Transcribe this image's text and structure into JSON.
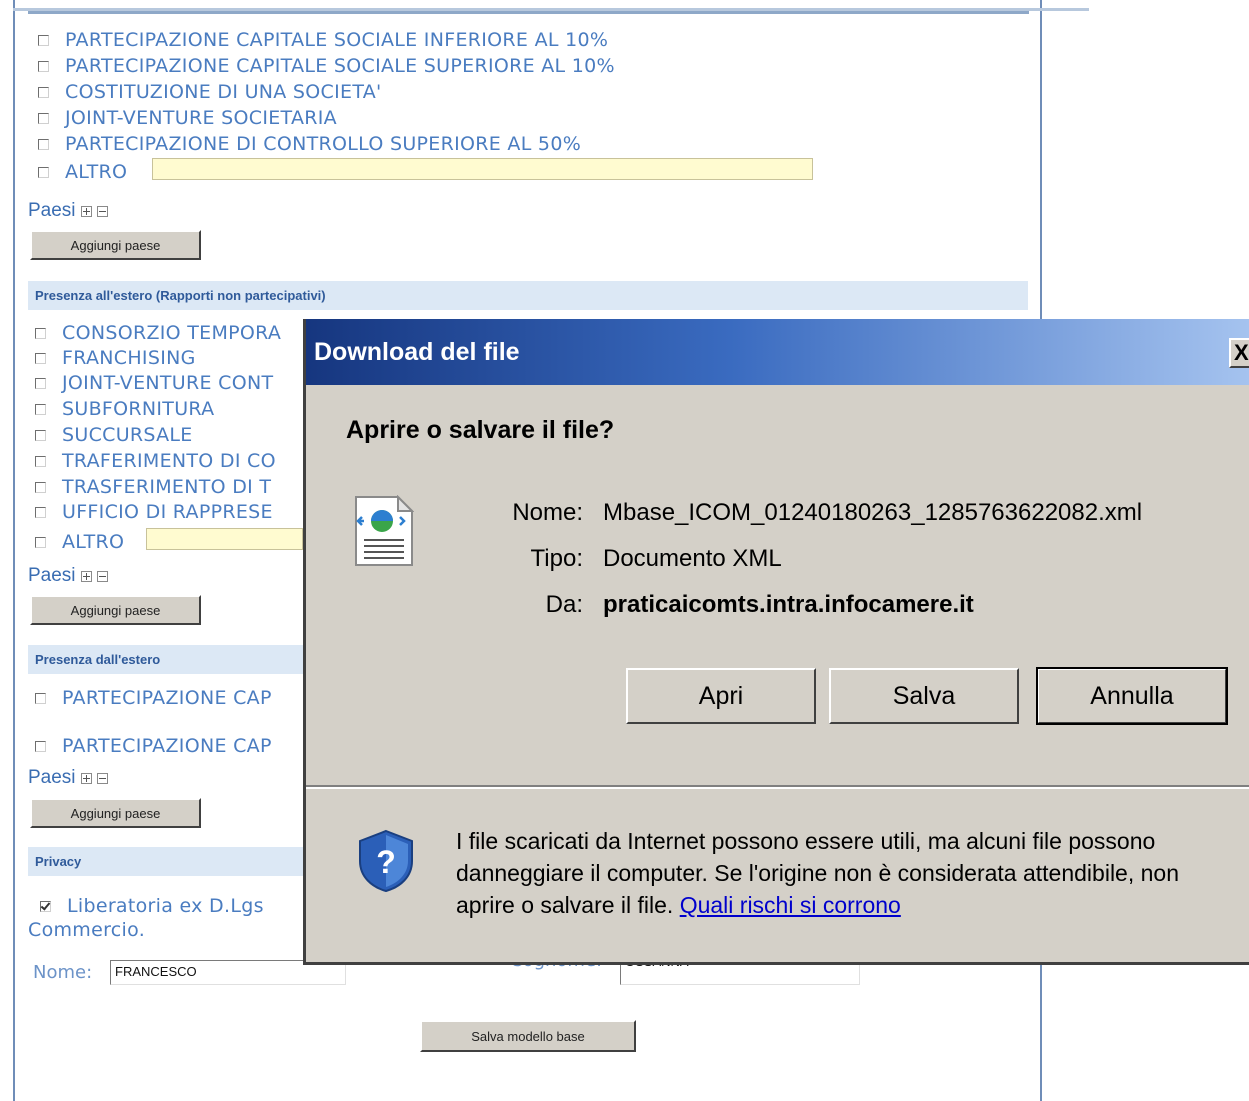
{
  "participations": {
    "options": [
      "PARTECIPAZIONE CAPITALE SOCIALE INFERIORE AL 10%",
      "PARTECIPAZIONE CAPITALE SOCIALE SUPERIORE AL 10%",
      "COSTITUZIONE DI UNA SOCIETA'",
      "JOINT-VENTURE SOCIETARIA",
      "PARTECIPAZIONE DI CONTROLLO SUPERIORE AL 50%",
      "ALTRO"
    ]
  },
  "paesi_label": "Paesi",
  "add_country_label": "Aggiungi paese",
  "section_non_participative": {
    "title": "Presenza all'estero (Rapporti non partecipativi)",
    "options": [
      "CONSORZIO TEMPORA",
      "FRANCHISING",
      "JOINT-VENTURE CONT",
      "SUBFORNITURA",
      "SUCCURSALE",
      "TRAFERIMENTO DI CO",
      "TRASFERIMENTO DI T",
      "UFFICIO DI RAPPRESE",
      "ALTRO"
    ]
  },
  "section_from_abroad": {
    "title": "Presenza dall'estero",
    "options": [
      "PARTECIPAZIONE CAP",
      "PARTECIPAZIONE CAP"
    ]
  },
  "privacy": {
    "title": "Privacy",
    "consent_text_line1": "Liberatoria ex D.Lgs",
    "consent_text_line2": "Commercio.",
    "nome_label": "Nome:",
    "nome_value": "FRANCESCO",
    "cognome_label": "Cognome:",
    "cognome_value": "OSSANNA",
    "save_button": "Salva modello base"
  },
  "dialog": {
    "title": "Download del file",
    "close": "X",
    "question": "Aprire o salvare il file?",
    "labels": {
      "name": "Nome:",
      "type": "Tipo:",
      "from": "Da:"
    },
    "file_name": "Mbase_ICOM_01240180263_1285763622082.xml",
    "file_type": "Documento XML",
    "source": "praticaicomts.intra.infocamere.it",
    "buttons": {
      "open": "Apri",
      "save": "Salva",
      "cancel": "Annulla"
    },
    "warning_text": "I file scaricati da Internet possono essere utili, ma alcuni file possono danneggiare il computer. Se l'origine non è considerata attendibile, non aprire o salvare il file. ",
    "warning_link": "Quali rischi si corrono"
  }
}
